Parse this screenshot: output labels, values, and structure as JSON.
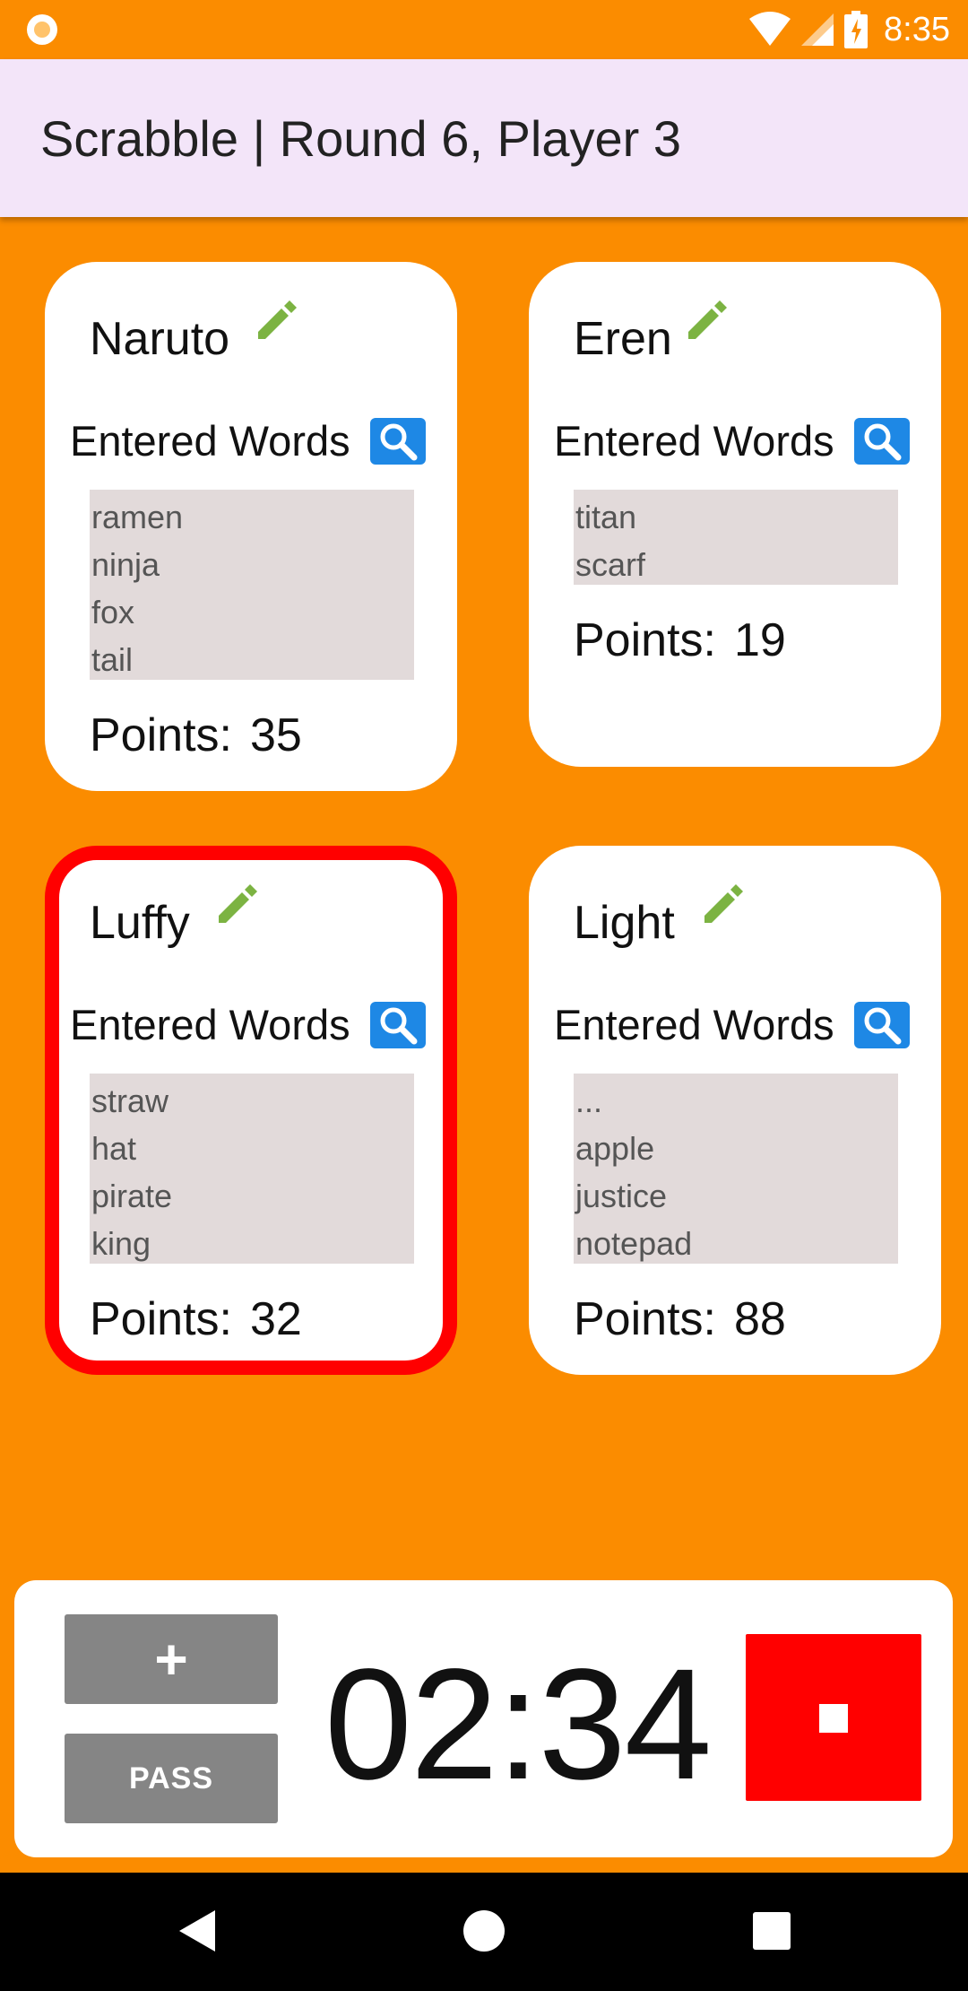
{
  "status_bar": {
    "time": "8:35"
  },
  "app_bar": {
    "title": "Scrabble | Round 6, Player 3"
  },
  "players": [
    {
      "name": "Naruto",
      "words_label": "Entered Words",
      "words": [
        "ramen",
        "ninja",
        "fox",
        "tail"
      ],
      "points_label": "Points:",
      "points": "35",
      "active": false
    },
    {
      "name": "Eren",
      "words_label": "Entered Words",
      "words": [
        "titan",
        "scarf"
      ],
      "points_label": "Points:",
      "points": "19",
      "active": false
    },
    {
      "name": "Luffy",
      "words_label": "Entered Words",
      "words": [
        "straw",
        "hat",
        "pirate",
        "king"
      ],
      "points_label": "Points:",
      "points": "32",
      "active": true
    },
    {
      "name": "Light",
      "words_label": "Entered Words",
      "words": [
        "...",
        "apple",
        "justice",
        "notepad"
      ],
      "points_label": "Points:",
      "points": "88",
      "active": false
    }
  ],
  "controls": {
    "add_label": "+",
    "pass_label": "PASS",
    "timer": "02:34"
  },
  "colors": {
    "background": "#FB8C00",
    "app_bar": "#F3E5F9",
    "active_border": "#FF0000",
    "edit_icon": "#7CB342",
    "search_icon": "#1E88E5",
    "stop_button": "#FF0000"
  }
}
